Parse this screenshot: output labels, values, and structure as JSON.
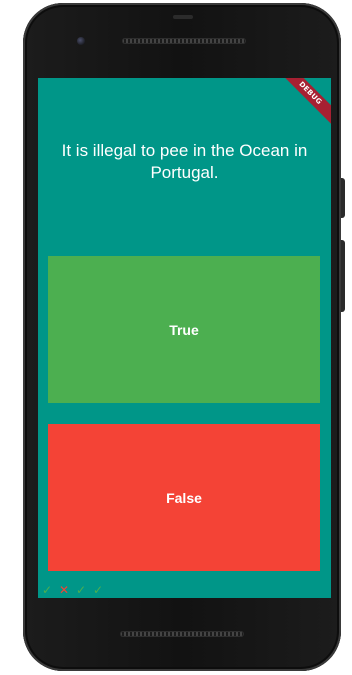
{
  "app": {
    "debug_banner": "DEBUG",
    "background_color": "#009688"
  },
  "quiz": {
    "question": "It is illegal to pee in the Ocean in Portugal.",
    "true_label": "True",
    "false_label": "False",
    "true_color": "#4caf50",
    "false_color": "#f44336"
  },
  "score_keeper": [
    {
      "icon": "check-icon",
      "symbol": "✓",
      "result": "correct"
    },
    {
      "icon": "close-icon",
      "symbol": "✕",
      "result": "wrong"
    },
    {
      "icon": "check-icon",
      "symbol": "✓",
      "result": "correct"
    },
    {
      "icon": "check-icon",
      "symbol": "✓",
      "result": "correct"
    }
  ]
}
